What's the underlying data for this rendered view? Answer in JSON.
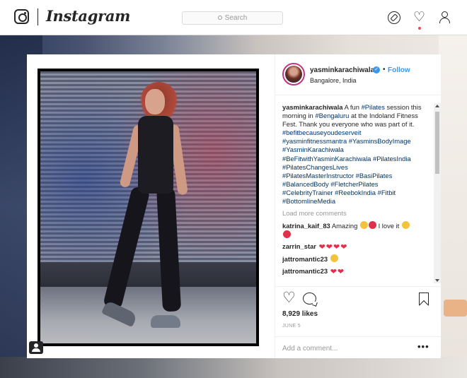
{
  "nav": {
    "brand": "Instagram",
    "search_placeholder": "Search",
    "icons": [
      "compass-icon",
      "heart-icon",
      "user-icon"
    ],
    "notification_color": "#ed4956"
  },
  "post": {
    "username": "yasminkarachiwala",
    "separator": "•",
    "follow_label": "Follow",
    "location": "Bangalore, India",
    "verified_mark": "✓",
    "caption": {
      "user": "yasminkarachiwala",
      "pre": "A fun ",
      "tag1": "#Pilates",
      "mid": " session this morning in ",
      "tag2": "#Bengaluru",
      "post": " at the Indoland Fitness Fest. Thank you everyone who was part of it.",
      "hashtags": [
        "#befitbecauseyoudeserveit",
        "#yasminfitnessmantra #YasminsBodyImage",
        "#YasminKarachiwala",
        "#BeFitwithYasminKarachiwala #PilatesIndia",
        "#PilatesChangesLives",
        "#PilatesMasterInstructor #BasiPilates",
        "#BalancedBody #FletcherPilates",
        "#CelebrityTrainer #ReebokIndia #Fitbit",
        "#BottomlineMedia"
      ]
    },
    "load_more": "Load more comments",
    "comments": [
      {
        "user": "katrina_kaif_83",
        "text": "Amazing",
        "text2": "I love it"
      },
      {
        "user": "zarrin_star",
        "text": ""
      },
      {
        "user": "jattromantic23",
        "text": ""
      },
      {
        "user": "jattromantic23",
        "text": ""
      }
    ],
    "heart_emoji": "❤",
    "likes": "8,929 likes",
    "date": "JUNE 5",
    "add_comment_placeholder": "Add a comment...",
    "more_label": "•••",
    "heart_outline": "♡",
    "accent_blue": "#3897f0"
  }
}
